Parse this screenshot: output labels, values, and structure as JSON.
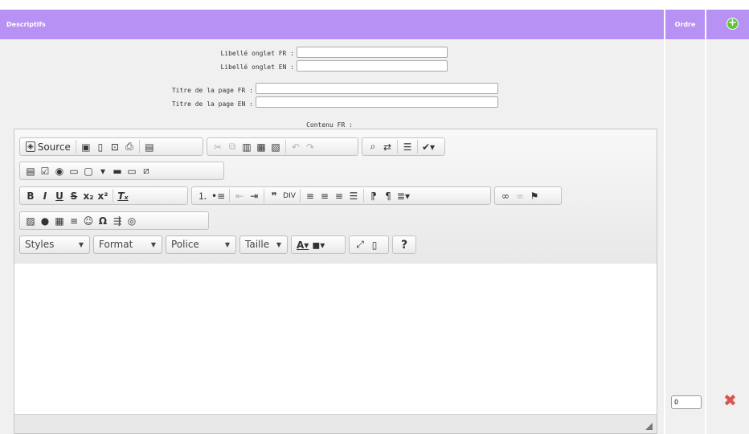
{
  "header": {
    "descriptifs": "Descriptifs",
    "ordre": "Ordre",
    "add_icon": "plus-circle-icon"
  },
  "form": {
    "libelle_fr_label": "Libellé onglet FR :",
    "libelle_en_label": "Libellé onglet EN :",
    "titre_fr_label": "Titre de la page FR :",
    "titre_en_label": "Titre de la page EN :",
    "contenu_label": "Contenu FR :",
    "libelle_fr_value": "",
    "libelle_en_value": "",
    "titre_fr_value": "",
    "titre_en_value": ""
  },
  "editor": {
    "source_label": "Source",
    "styles_label": "Styles",
    "format_label": "Format",
    "police_label": "Police",
    "taille_label": "Taille",
    "help_label": "?",
    "content": ""
  },
  "row": {
    "ordre_value": "0",
    "delete_icon": "close-icon",
    "delete_color": "#d9534f"
  },
  "colors": {
    "header_bg": "#b891f4",
    "add_green": "#5cc53a"
  }
}
